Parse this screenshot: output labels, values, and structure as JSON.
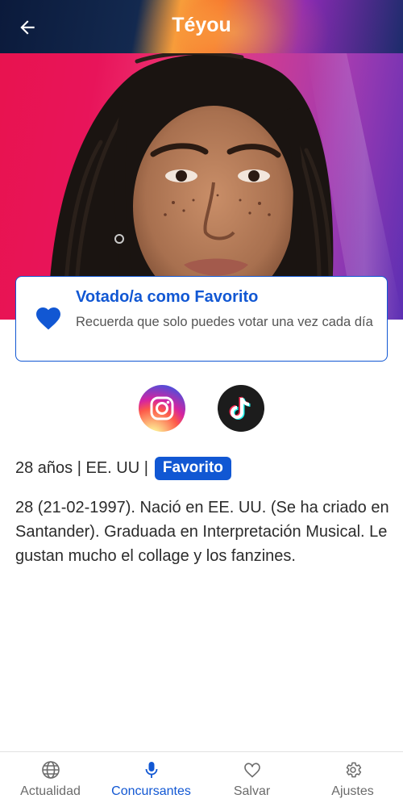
{
  "header": {
    "title": "Téyou",
    "back_icon": "arrow-left-icon"
  },
  "hero": {
    "image": "contestant-portrait"
  },
  "vote_card": {
    "icon": "heart-icon",
    "title": "Votado/a como Favorito",
    "description": "Recuerda que solo puedes votar una vez cada día"
  },
  "social": [
    {
      "name": "Instagram",
      "icon": "instagram-icon"
    },
    {
      "name": "TikTok",
      "icon": "tiktok-icon"
    }
  ],
  "info": {
    "summary": "28 años | EE. UU |",
    "badge": "Favorito"
  },
  "bio": "28 (21-02-1997). Nació en EE. UU. (Se ha criado en Santander). Graduada en Interpretación Musical. Le gustan mucho el collage y los fanzines.",
  "nav": {
    "items": [
      {
        "label": "Actualidad",
        "icon": "globe-icon"
      },
      {
        "label": "Concursantes",
        "icon": "microphone-icon",
        "active": true
      },
      {
        "label": "Salvar",
        "icon": "heart-outline-icon"
      },
      {
        "label": "Ajustes",
        "icon": "gear-icon"
      }
    ]
  },
  "colors": {
    "accent": "#1157d3",
    "text": "#2b2b2b",
    "muted": "#6b6b6b"
  }
}
